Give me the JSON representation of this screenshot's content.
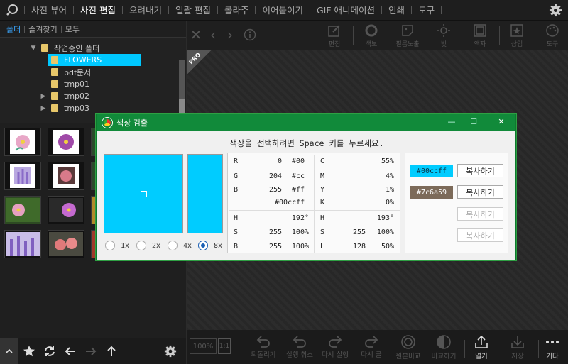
{
  "menu": {
    "items": [
      {
        "label": "사진 뷰어"
      },
      {
        "label": "사진 편집"
      },
      {
        "label": "오려내기"
      },
      {
        "label": "일괄 편집"
      },
      {
        "label": "콜라주"
      },
      {
        "label": "이어붙이기"
      },
      {
        "label": "GIF 애니메이션"
      },
      {
        "label": "인쇄"
      },
      {
        "label": "도구"
      }
    ],
    "active_index": 1
  },
  "left": {
    "tabs": [
      "폴더",
      "즐겨찾기",
      "모두"
    ],
    "tree": {
      "items": [
        {
          "label": "작업중인 폴더",
          "expanded": true
        },
        {
          "label": "FLOWERS",
          "selected": true
        },
        {
          "label": "pdf문서"
        },
        {
          "label": "tmp01"
        },
        {
          "label": "tmp02"
        },
        {
          "label": "tmp03"
        }
      ]
    }
  },
  "editor": {
    "tools": [
      "편집",
      "색보",
      "필름노출",
      "빛",
      "액자",
      "삽입",
      "도구"
    ],
    "badge": "PRO",
    "zoom": "100%",
    "zoom_fit": "1:1",
    "bottom_tools": [
      "되돌리기",
      "실행 취소",
      "다시 실행",
      "다시 글",
      "원본비교",
      "비교하기",
      "열기",
      "저장",
      "기타"
    ]
  },
  "dialog": {
    "title": "색상 검출",
    "hint": "색상을 선택하려면 Space 키를 누르세요.",
    "picked_color": "#00ccff",
    "zoom_options": [
      "1x",
      "2x",
      "4x",
      "8x"
    ],
    "zoom_selected": 3,
    "rgb": {
      "r": {
        "label": "R",
        "value": "0",
        "hex": "#00"
      },
      "g": {
        "label": "G",
        "value": "204",
        "hex": "#cc"
      },
      "b": {
        "label": "B",
        "value": "255",
        "hex": "#ff"
      },
      "hex_full": "#00ccff"
    },
    "cmyk": {
      "c": {
        "label": "C",
        "value": "55%"
      },
      "m": {
        "label": "M",
        "value": "4%"
      },
      "y": {
        "label": "Y",
        "value": "1%"
      },
      "k": {
        "label": "K",
        "value": "0%"
      }
    },
    "hsv": {
      "h": {
        "label": "H",
        "value": "192°"
      },
      "s": {
        "label": "S",
        "value": "255",
        "pct": "100%"
      },
      "b": {
        "label": "B",
        "value": "255",
        "pct": "100%"
      }
    },
    "hsl": {
      "h": {
        "label": "H",
        "value": "193°"
      },
      "s": {
        "label": "S",
        "value": "255",
        "pct": "100%"
      },
      "l": {
        "label": "L",
        "value": "128",
        "pct": "50%"
      }
    },
    "swatches": [
      {
        "hex": "#00ccff",
        "bg": "#00ccff"
      },
      {
        "hex": "#7c6a59",
        "bg": "#7c6a59"
      }
    ],
    "copy_label": "복사하기"
  }
}
